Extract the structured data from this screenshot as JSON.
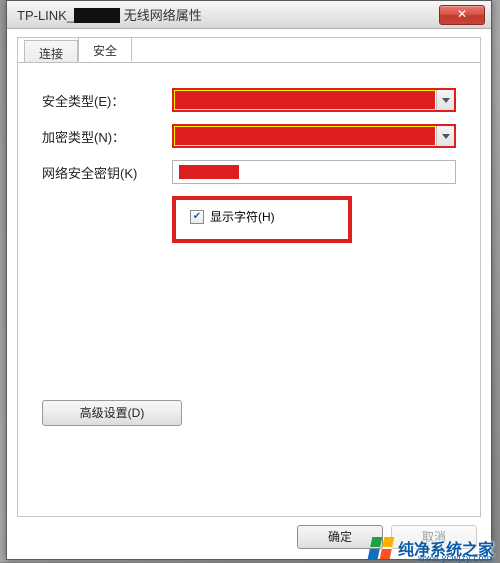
{
  "window": {
    "title_prefix": "TP-LINK_",
    "title_suffix": " 无线网络属性",
    "close_glyph": "✕"
  },
  "tabs": {
    "connect": "连接",
    "security": "安全"
  },
  "labels": {
    "security_type": "安全类型(E)：",
    "encryption_type": "加密类型(N)：",
    "network_key": "网络安全密钥(K)",
    "show_chars": "显示字符(H)",
    "advanced": "高级设置(D)"
  },
  "buttons": {
    "ok": "确定",
    "cancel": "取消"
  },
  "state": {
    "show_chars_checked": true
  },
  "watermark": {
    "text": "纯净系统之家",
    "url": "www.ycwjzy.com"
  }
}
